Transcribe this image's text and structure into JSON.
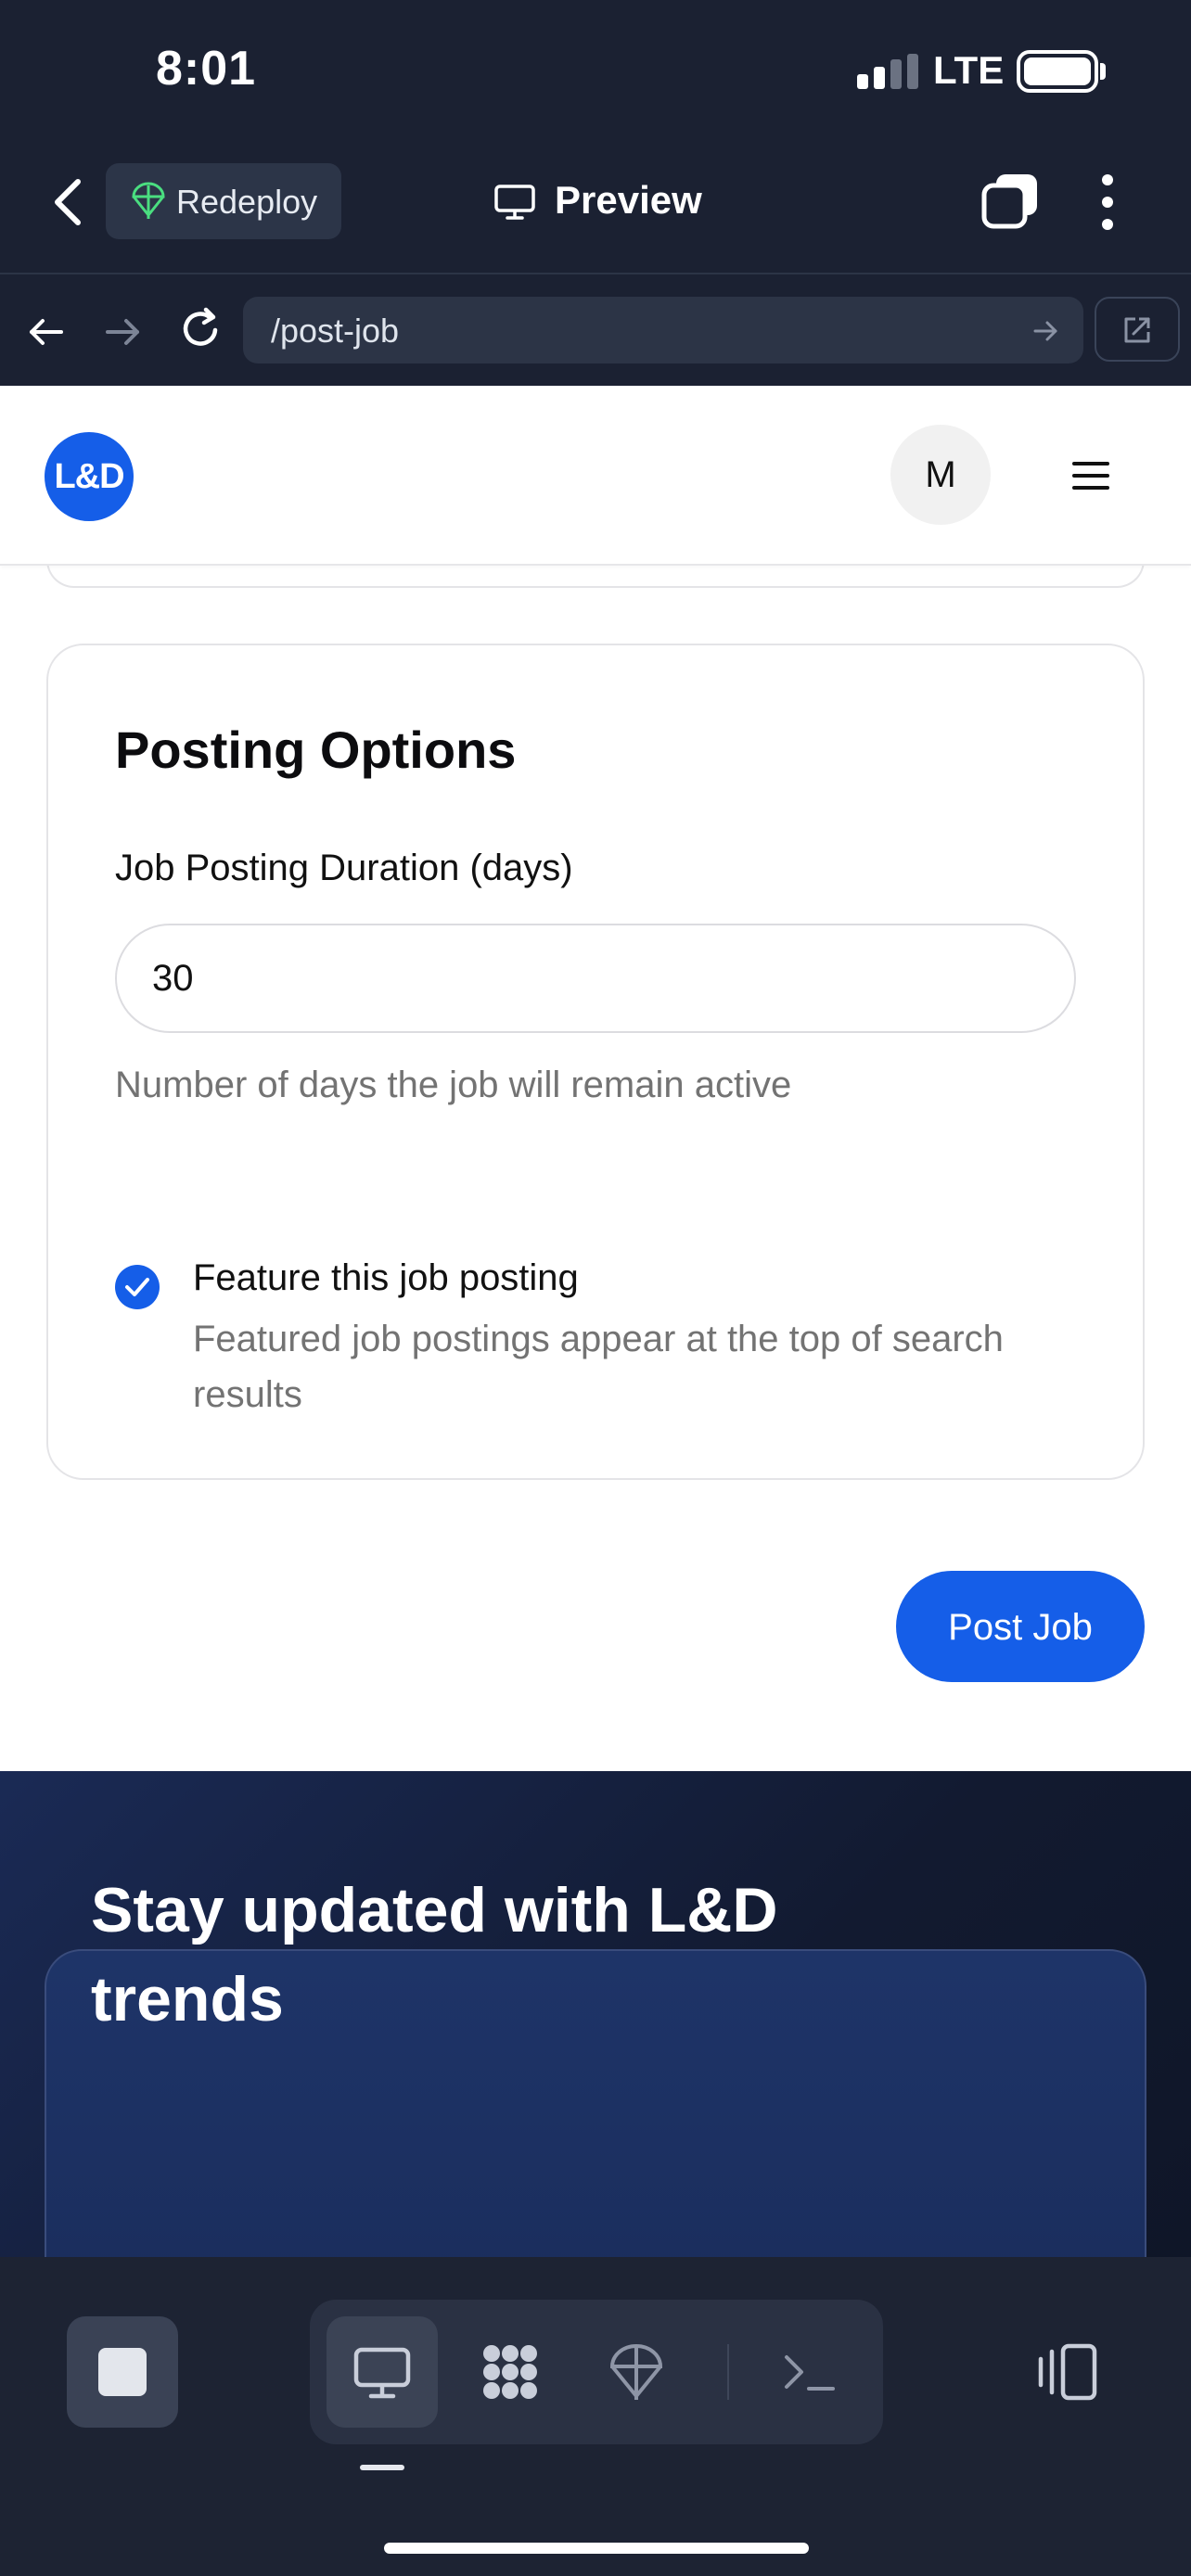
{
  "status_bar": {
    "time": "8:01",
    "network": "LTE"
  },
  "app_bar": {
    "redeploy_label": "Redeploy",
    "preview_label": "Preview"
  },
  "browser": {
    "url": "/post-job"
  },
  "site_header": {
    "logo_text": "L&D",
    "avatar_initial": "M"
  },
  "posting_options": {
    "title": "Posting Options",
    "duration_label": "Job Posting Duration (days)",
    "duration_value": "30",
    "duration_hint": "Number of days the job will remain active",
    "feature_checked": true,
    "feature_label": "Feature this job posting",
    "feature_description": "Featured job postings appear at the top of search results"
  },
  "actions": {
    "post_job_label": "Post Job"
  },
  "newsletter": {
    "title": "Stay updated with L&D trends"
  },
  "colors": {
    "primary": "#155ee8",
    "chrome_bg": "#1b2132",
    "muted_text": "#737373"
  },
  "toolbar": {
    "icons": [
      "stop-icon",
      "desktop-icon",
      "grid-dots-icon",
      "parachute-icon",
      "terminal-icon",
      "split-view-icon"
    ],
    "active": "desktop-icon"
  }
}
